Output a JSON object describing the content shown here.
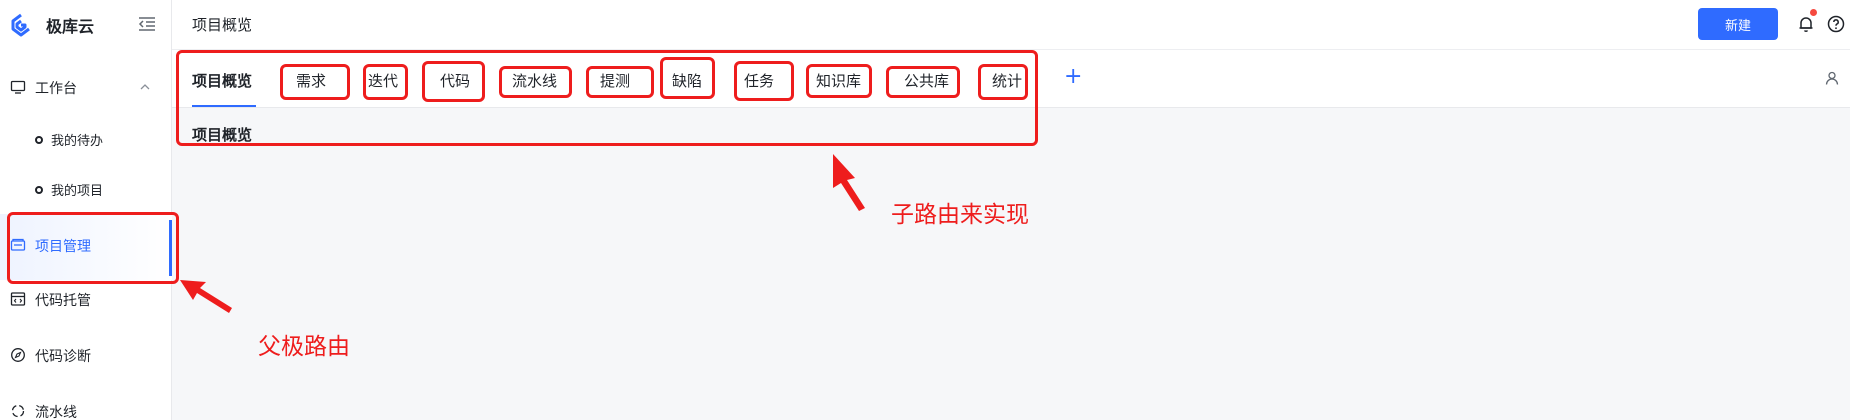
{
  "brand": {
    "name": "极库云"
  },
  "sidebar": {
    "items": [
      {
        "label": "工作台",
        "icon": "monitor-icon"
      },
      {
        "label": "我的待办",
        "icon": "dot"
      },
      {
        "label": "我的项目",
        "icon": "dot"
      },
      {
        "label": "项目管理",
        "icon": "folder-icon"
      },
      {
        "label": "代码托管",
        "icon": "code-icon"
      },
      {
        "label": "代码诊断",
        "icon": "compass-icon"
      },
      {
        "label": "流水线",
        "icon": "pipeline-icon"
      }
    ]
  },
  "header": {
    "title": "项目概览",
    "new_label": "新建"
  },
  "tabs": [
    {
      "label": "项目概览"
    },
    {
      "label": "需求"
    },
    {
      "label": "迭代"
    },
    {
      "label": "代码"
    },
    {
      "label": "流水线"
    },
    {
      "label": "提测"
    },
    {
      "label": "缺陷"
    },
    {
      "label": "任务"
    },
    {
      "label": "知识库"
    },
    {
      "label": "公共库"
    },
    {
      "label": "统计"
    }
  ],
  "tab_add": "+",
  "content": {
    "title": "项目概览"
  },
  "annotations": {
    "child": "子路由来实现",
    "parent": "父极路由"
  },
  "colors": {
    "accent": "#2f6bff",
    "annotation": "#ee1d1d"
  }
}
